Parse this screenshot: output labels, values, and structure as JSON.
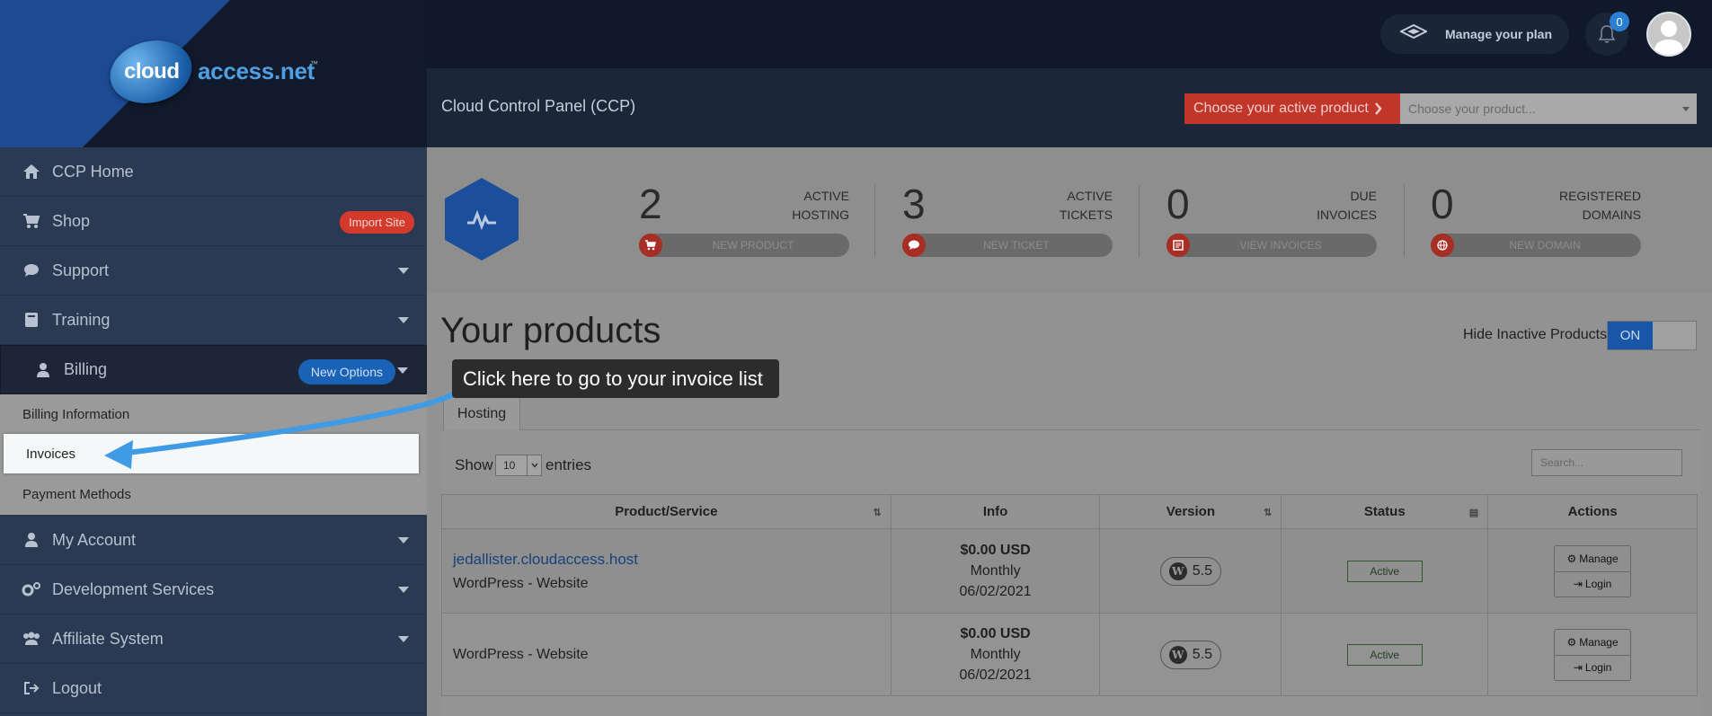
{
  "brand": {
    "cloud": "cloud",
    "access": "access.net",
    "tm": "™"
  },
  "header": {
    "plan_label": "Manage your plan",
    "notifications_count": "0",
    "ccp_title": "Cloud Control Panel (CCP)",
    "choose_product_label": "Choose your active product",
    "choose_product_placeholder": "Choose your product..."
  },
  "sidebar": {
    "items": [
      {
        "label": "CCP Home",
        "icon": "home-icon"
      },
      {
        "label": "Shop",
        "icon": "cart-icon",
        "badge": "Import Site"
      },
      {
        "label": "Support",
        "icon": "chat-icon"
      },
      {
        "label": "Training",
        "icon": "book-icon"
      },
      {
        "label": "Billing",
        "icon": "user-icon",
        "badge": "New Options"
      }
    ],
    "billing_submenu": [
      "Billing Information",
      "Invoices",
      "Payment Methods"
    ],
    "items_after": [
      {
        "label": "My Account",
        "icon": "user-icon"
      },
      {
        "label": "Development Services",
        "icon": "cogs-icon"
      },
      {
        "label": "Affiliate System",
        "icon": "users-icon"
      },
      {
        "label": "Logout",
        "icon": "logout-icon"
      }
    ]
  },
  "stats": [
    {
      "count": "2",
      "label_line1": "ACTIVE",
      "label_line2": "HOSTING",
      "action": "NEW PRODUCT"
    },
    {
      "count": "3",
      "label_line1": "ACTIVE",
      "label_line2": "TICKETS",
      "action": "NEW TICKET"
    },
    {
      "count": "0",
      "label_line1": "DUE",
      "label_line2": "INVOICES",
      "action": "VIEW INVOICES"
    },
    {
      "count": "0",
      "label_line1": "REGISTERED",
      "label_line2": "DOMAINS",
      "action": "NEW DOMAIN"
    }
  ],
  "products": {
    "title": "Your products",
    "hide_inactive_label": "Hide Inactive Products",
    "toggle_state": "ON",
    "tab": "Hosting",
    "show_label": "Show",
    "entries_value": "10",
    "entries_label": "entries",
    "search_placeholder": "Search...",
    "columns": [
      "Product/Service",
      "Info",
      "Version",
      "Status",
      "Actions"
    ],
    "rows": [
      {
        "domain": "jedallister.cloudaccess.host",
        "type": "WordPress - Website",
        "price": "$0.00 USD",
        "cycle": "Monthly",
        "date": "06/02/2021",
        "version": "5.5",
        "status": "Active"
      },
      {
        "domain": "",
        "type": "WordPress - Website",
        "price": "$0.00 USD",
        "cycle": "Monthly",
        "date": "06/02/2021",
        "version": "5.5",
        "status": "Active"
      }
    ],
    "manage_label": "Manage",
    "login_label": "Login"
  },
  "tooltip": {
    "text": "Click here to go to your invoice list"
  },
  "colors": {
    "accent_red": "#c0362b",
    "brand_blue": "#1b4f9b",
    "arrow_blue": "#3f9be6"
  }
}
